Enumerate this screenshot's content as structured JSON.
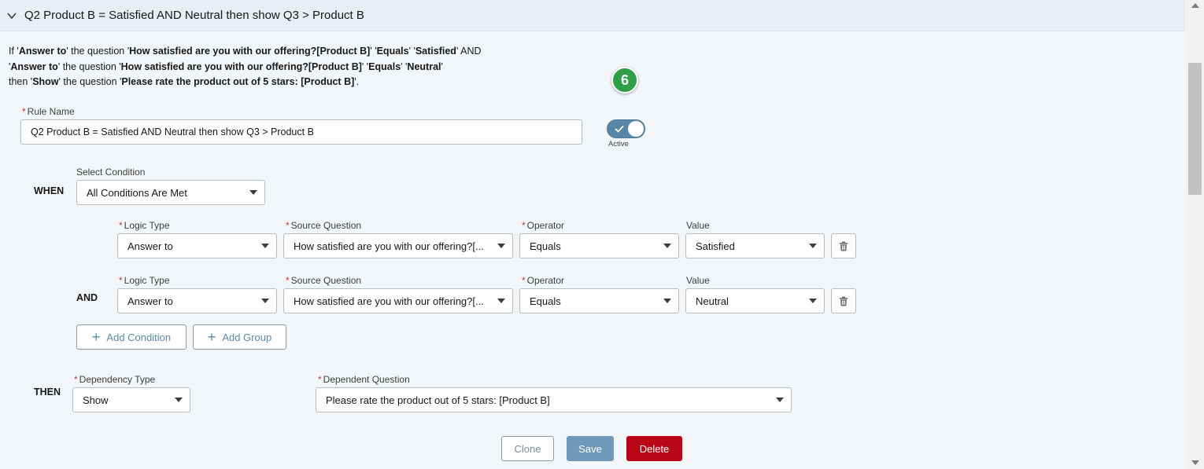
{
  "header": {
    "title": "Q2 Product B = Satisfied AND Neutral then show Q3 > Product B"
  },
  "summary": {
    "line1": [
      {
        "t": "If '",
        "b": false
      },
      {
        "t": "Answer to",
        "b": true
      },
      {
        "t": "' the question '",
        "b": false
      },
      {
        "t": "How satisfied are you with our offering?[Product B]",
        "b": true
      },
      {
        "t": "' '",
        "b": false
      },
      {
        "t": "Equals",
        "b": true
      },
      {
        "t": "' '",
        "b": false
      },
      {
        "t": "Satisfied",
        "b": true
      },
      {
        "t": "' AND",
        "b": false
      }
    ],
    "line2": [
      {
        "t": "'",
        "b": false
      },
      {
        "t": "Answer to",
        "b": true
      },
      {
        "t": "' the question '",
        "b": false
      },
      {
        "t": "How satisfied are you with our offering?[Product B]",
        "b": true
      },
      {
        "t": "' '",
        "b": false
      },
      {
        "t": "Equals",
        "b": true
      },
      {
        "t": "' '",
        "b": false
      },
      {
        "t": "Neutral",
        "b": true
      },
      {
        "t": "'",
        "b": false
      }
    ],
    "line3": [
      {
        "t": "then '",
        "b": false
      },
      {
        "t": "Show",
        "b": true
      },
      {
        "t": "' the question '",
        "b": false
      },
      {
        "t": "Please rate the product out of 5 stars: [Product B]",
        "b": true
      },
      {
        "t": "'.",
        "b": false
      }
    ]
  },
  "step_badge": "6",
  "rule_name": {
    "label": "Rule Name",
    "value": "Q2 Product B = Satisfied AND Neutral then show Q3 > Product B"
  },
  "active_toggle": {
    "label": "Active",
    "on": true
  },
  "when": {
    "keyword": "WHEN",
    "select_label": "Select Condition",
    "select_value": "All Conditions Are Met"
  },
  "condition_labels": {
    "logic_type": "Logic Type",
    "source_question": "Source Question",
    "operator": "Operator",
    "value": "Value"
  },
  "conditions": [
    {
      "prefix": "",
      "logic_type": "Answer to",
      "source_question": "How satisfied are you with our offering?[...",
      "operator": "Equals",
      "value": "Satisfied"
    },
    {
      "prefix": "AND",
      "logic_type": "Answer to",
      "source_question": "How satisfied are you with our offering?[...",
      "operator": "Equals",
      "value": "Neutral"
    }
  ],
  "buttons": {
    "add_condition": "Add Condition",
    "add_group": "Add Group",
    "clone": "Clone",
    "save": "Save",
    "delete": "Delete"
  },
  "then": {
    "keyword": "THEN",
    "dependency_type_label": "Dependency Type",
    "dependency_type_value": "Show",
    "dependent_question_label": "Dependent Question",
    "dependent_question_value": "Please rate the product out of 5 stars: [Product B]"
  },
  "colors": {
    "header_bg": "#e8eef4",
    "toggle_on": "#5a86a6",
    "save_bg": "#6f99b8",
    "delete_bg": "#ba0517",
    "badge": "#2e9f47",
    "required": "#c23934"
  }
}
